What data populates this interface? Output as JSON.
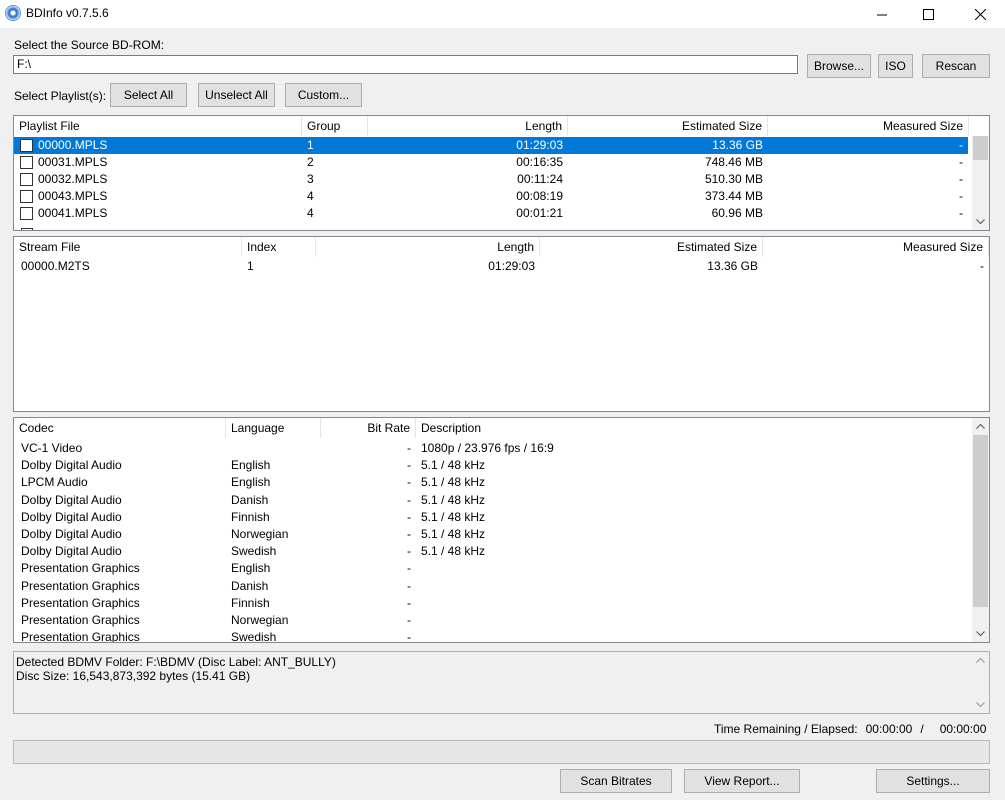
{
  "window": {
    "title": "BDInfo v0.7.5.6"
  },
  "source": {
    "label": "Select the Source BD-ROM:",
    "path": "F:\\",
    "browse_label": "Browse...",
    "iso_label": "ISO",
    "rescan_label": "Rescan"
  },
  "playlist_select": {
    "label": "Select Playlist(s):",
    "select_all_label": "Select All",
    "unselect_all_label": "Unselect All",
    "custom_label": "Custom..."
  },
  "playlists": {
    "columns": [
      "Playlist File",
      "Group",
      "Length",
      "Estimated Size",
      "Measured Size"
    ],
    "rows": [
      {
        "file": "00000.MPLS",
        "group": "1",
        "length": "01:29:03",
        "estimated": "13.36 GB",
        "measured": "-",
        "selected": true
      },
      {
        "file": "00031.MPLS",
        "group": "2",
        "length": "00:16:35",
        "estimated": "748.46 MB",
        "measured": "-"
      },
      {
        "file": "00032.MPLS",
        "group": "3",
        "length": "00:11:24",
        "estimated": "510.30 MB",
        "measured": "-"
      },
      {
        "file": "00043.MPLS",
        "group": "4",
        "length": "00:08:19",
        "estimated": "373.44 MB",
        "measured": "-"
      },
      {
        "file": "00041.MPLS",
        "group": "4",
        "length": "00:01:21",
        "estimated": "60.96 MB",
        "measured": "-"
      }
    ]
  },
  "streams": {
    "columns": [
      "Stream File",
      "Index",
      "Length",
      "Estimated Size",
      "Measured Size"
    ],
    "rows": [
      {
        "file": "00000.M2TS",
        "index": "1",
        "length": "01:29:03",
        "estimated": "13.36 GB",
        "measured": "-"
      }
    ]
  },
  "codecs": {
    "columns": [
      "Codec",
      "Language",
      "Bit Rate",
      "Description"
    ],
    "rows": [
      {
        "codec": "VC-1 Video",
        "language": "",
        "bitrate": "-",
        "description": "1080p / 23.976 fps / 16:9"
      },
      {
        "codec": "Dolby Digital Audio",
        "language": "English",
        "bitrate": "-",
        "description": "5.1 / 48 kHz"
      },
      {
        "codec": "LPCM Audio",
        "language": "English",
        "bitrate": "-",
        "description": "5.1 / 48 kHz"
      },
      {
        "codec": "Dolby Digital Audio",
        "language": "Danish",
        "bitrate": "-",
        "description": "5.1 / 48 kHz"
      },
      {
        "codec": "Dolby Digital Audio",
        "language": "Finnish",
        "bitrate": "-",
        "description": "5.1 / 48 kHz"
      },
      {
        "codec": "Dolby Digital Audio",
        "language": "Norwegian",
        "bitrate": "-",
        "description": "5.1 / 48 kHz"
      },
      {
        "codec": "Dolby Digital Audio",
        "language": "Swedish",
        "bitrate": "-",
        "description": "5.1 / 48 kHz"
      },
      {
        "codec": "Presentation Graphics",
        "language": "English",
        "bitrate": "-",
        "description": ""
      },
      {
        "codec": "Presentation Graphics",
        "language": "Danish",
        "bitrate": "-",
        "description": ""
      },
      {
        "codec": "Presentation Graphics",
        "language": "Finnish",
        "bitrate": "-",
        "description": ""
      },
      {
        "codec": "Presentation Graphics",
        "language": "Norwegian",
        "bitrate": "-",
        "description": ""
      },
      {
        "codec": "Presentation Graphics",
        "language": "Swedish",
        "bitrate": "-",
        "description": ""
      }
    ]
  },
  "info": {
    "line1": "Detected BDMV Folder: F:\\BDMV (Disc Label: ANT_BULLY)",
    "line2": "Disc Size: 16,543,873,392 bytes (15.41 GB)"
  },
  "status": {
    "time_label": "Time Remaining / Elapsed:",
    "remaining": "00:00:00",
    "separator": "/",
    "elapsed": "00:00:00",
    "progress": 0
  },
  "footer": {
    "scan_label": "Scan Bitrates",
    "report_label": "View Report...",
    "settings_label": "Settings..."
  },
  "colors": {
    "selection": "#0078d7",
    "window_bg": "#f0f0f0"
  }
}
